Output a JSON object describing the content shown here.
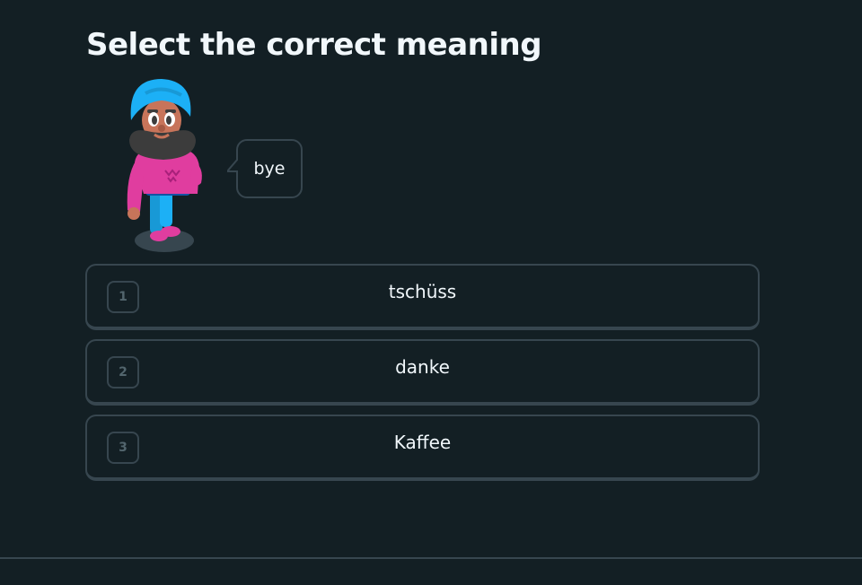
{
  "challenge": {
    "title": "Select the correct meaning",
    "prompt_word": "bye"
  },
  "character": {
    "icon": "turbaned-man-character-icon"
  },
  "options": [
    {
      "key": "1",
      "label": "tschüss"
    },
    {
      "key": "2",
      "label": "danke"
    },
    {
      "key": "3",
      "label": "Kaffee"
    }
  ],
  "colors": {
    "background": "#131f24",
    "border": "#37464f",
    "text": "#f1f7fb",
    "key_text": "#52656d",
    "character_turban": "#1cb0f6",
    "character_sweater": "#e03d9f",
    "character_beard": "#3c3c3c"
  }
}
